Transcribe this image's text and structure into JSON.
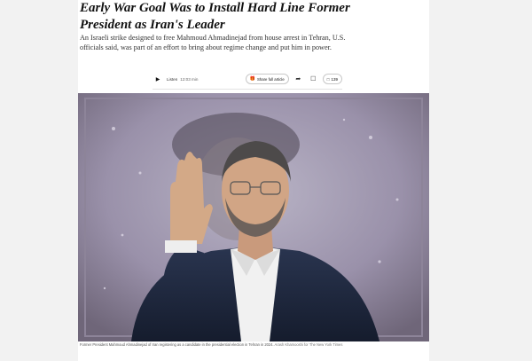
{
  "article": {
    "headline": "Early War Goal Was to Install Hard Line Former President as Iran's Leader",
    "summary": "An Israeli strike designed to free Mahmoud Ahmadinejad from house arrest in Tehran, U.S. officials said, was part of an effort to bring about regime change and put him in power."
  },
  "toolbar": {
    "listen_label": "Listen",
    "duration": "12:03 min",
    "share_label": "Share full article",
    "comments_count": "139"
  },
  "photo": {
    "caption": "Former President Mahmoud Ahmadinejad of Iran registering as a candidate in the presidential election in Tehran in 2024.",
    "credit": "Arash Khamooshi for The New York Times"
  }
}
